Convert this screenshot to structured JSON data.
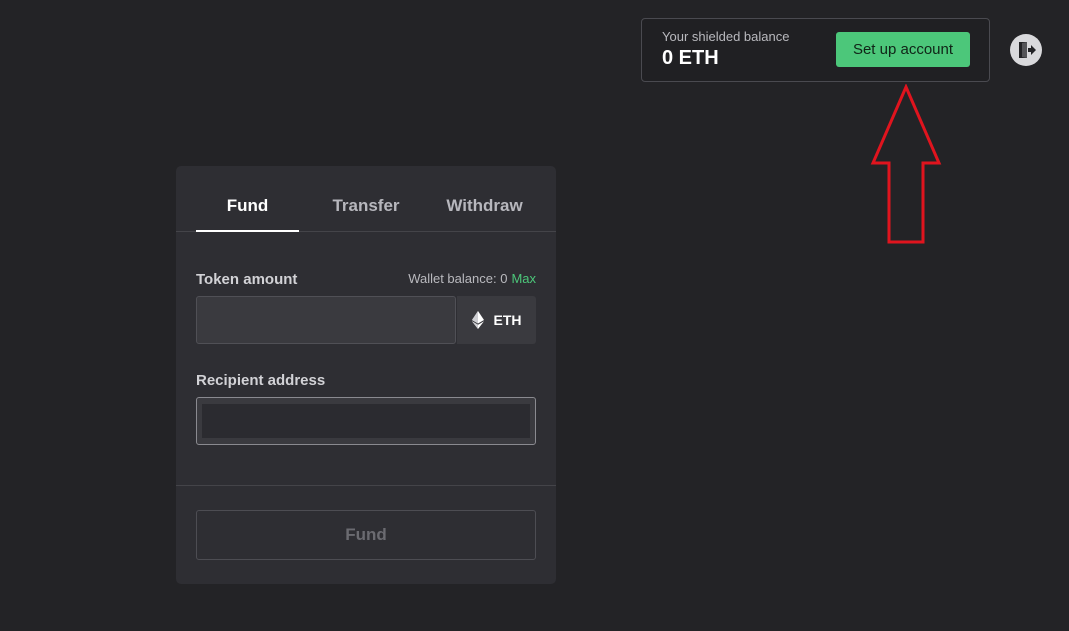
{
  "balance": {
    "label": "Your shielded balance",
    "value": "0 ETH",
    "setup_button": "Set up account"
  },
  "header": {
    "logout_icon": "logout-icon"
  },
  "tabs": [
    {
      "label": "Fund",
      "active": true
    },
    {
      "label": "Transfer",
      "active": false
    },
    {
      "label": "Withdraw",
      "active": false
    }
  ],
  "form": {
    "token_amount_label": "Token amount",
    "wallet_balance_text": "Wallet balance: 0",
    "max_label": "Max",
    "amount_value": "",
    "token_symbol": "ETH",
    "token_icon": "ethereum-icon",
    "recipient_label": "Recipient address",
    "recipient_value": "",
    "submit_label": "Fund"
  },
  "colors": {
    "background": "#232326",
    "card": "#2e2e33",
    "accent_green": "#4cc77a",
    "annotation_red": "#e0141e"
  }
}
